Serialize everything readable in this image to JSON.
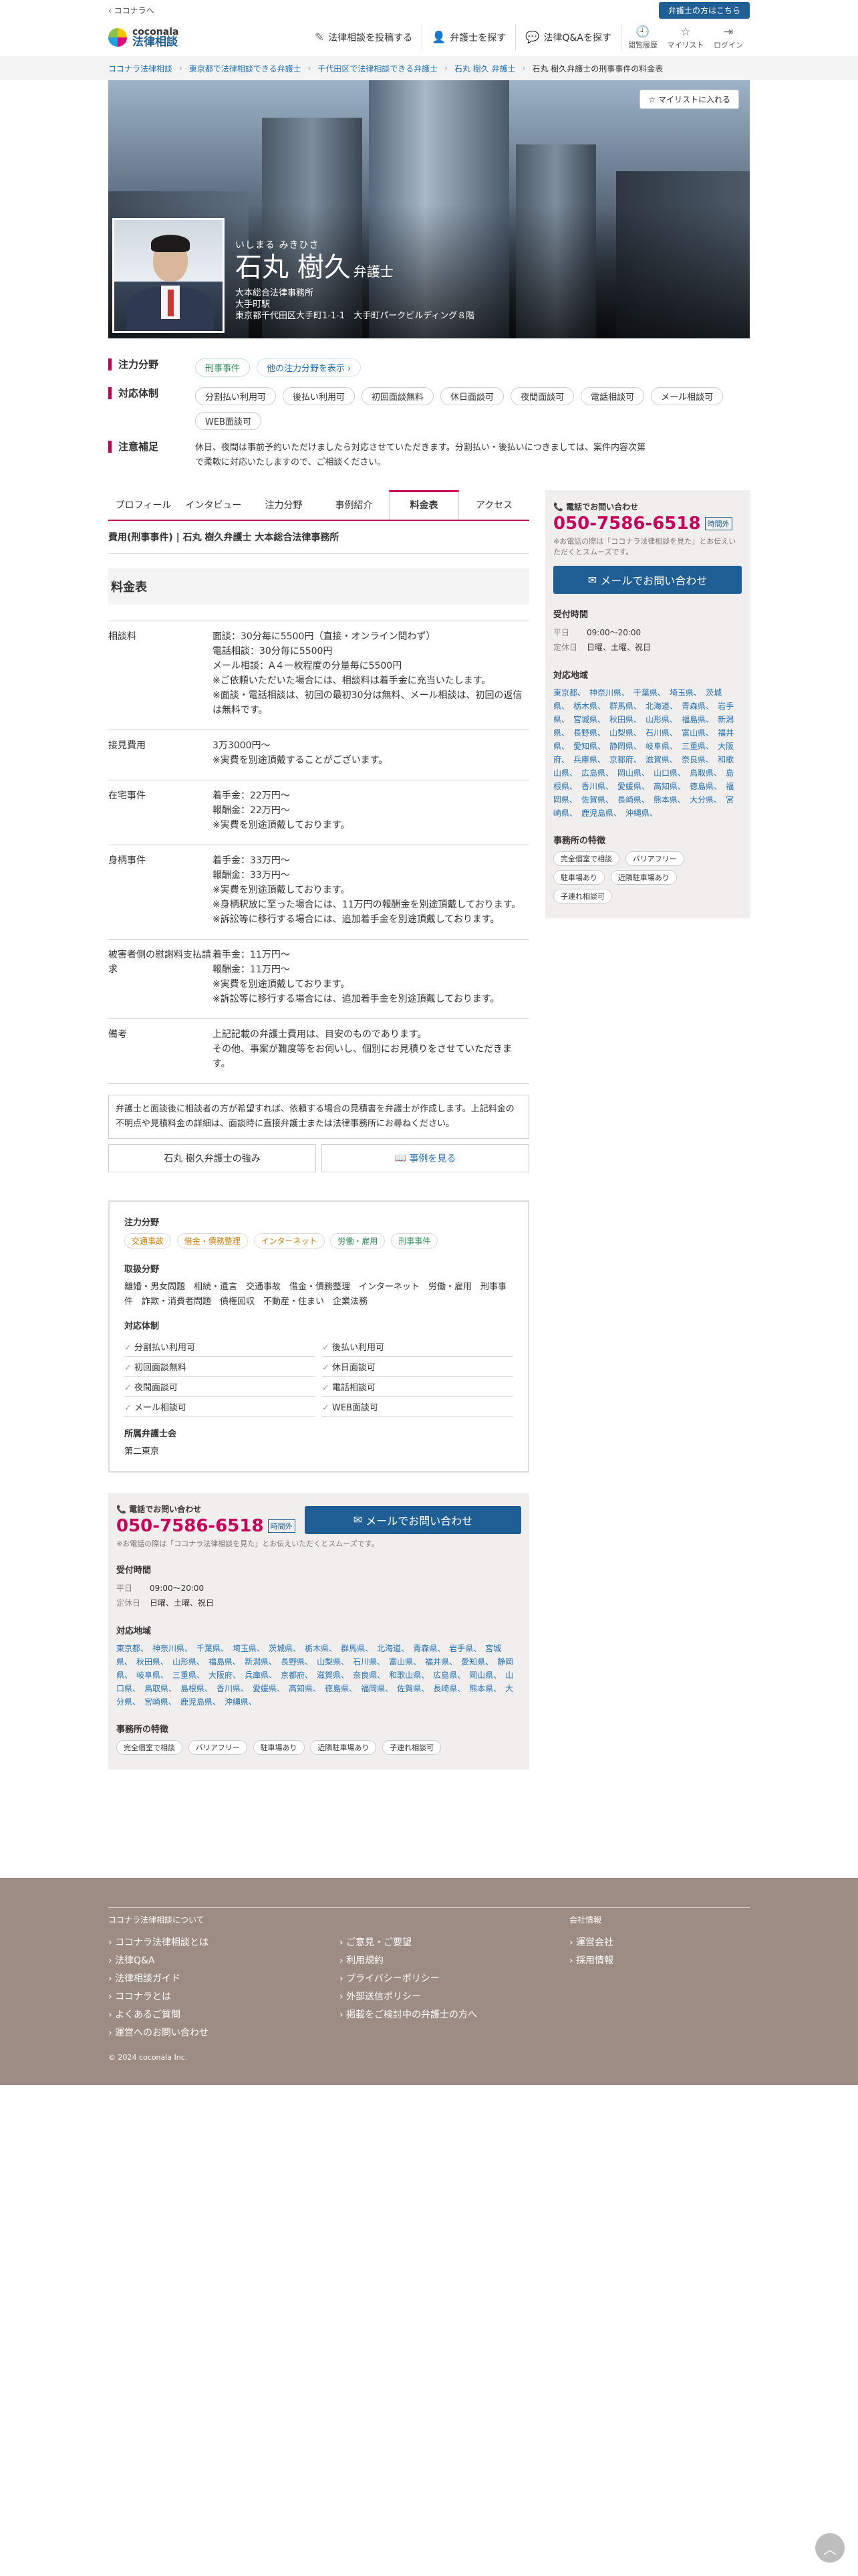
{
  "topbar": {
    "back": "‹ ココナラへ",
    "lawyer_btn": "弁護士の方はこちら"
  },
  "logo": {
    "line1": "coconala",
    "line2": "法律相談"
  },
  "nav": {
    "post": "法律相談を投稿する",
    "find": "弁護士を探す",
    "qa": "法律Q&Aを探す",
    "history": "閲覧履歴",
    "mylist": "マイリスト",
    "login": "ログイン"
  },
  "breadcrumb": [
    "ココナラ法律相談",
    "東京都で法律相談できる弁護士",
    "千代田区で法律相談できる弁護士",
    "石丸 樹久 弁護士",
    "石丸 樹久弁護士の刑事事件の料金表"
  ],
  "hero": {
    "fav": "マイリストに入れる",
    "kana": "いしまる みきひさ",
    "name": "石丸 樹久",
    "title": "弁護士",
    "firm": "大本総合法律事務所",
    "office": "大手町駅",
    "address": "東京都千代田区大手町1-1-1　大手町パークビルディング８階"
  },
  "features": {
    "focus_label": "注力分野",
    "focus_tag": "刑事事件",
    "focus_more": "他の注力分野を表示 ›",
    "support_label": "対応体制",
    "support_tags": [
      "分割払い利用可",
      "後払い利用可",
      "初回面談無料",
      "休日面談可",
      "夜間面談可",
      "電話相談可",
      "メール相談可",
      "WEB面談可"
    ],
    "note_label": "注意補足",
    "note_text": "休日、夜間は事前予約いただけましたら対応させていただきます。分割払い・後払いにつきましては、案件内容次第で柔軟に対応いたしますので、ご相談ください。"
  },
  "tabs": [
    "プロフィール",
    "インタビュー",
    "注力分野",
    "事例紹介",
    "料金表",
    "アクセス"
  ],
  "fee": {
    "subtitle": "費用(刑事事件) | 石丸 樹久弁護士 大本総合法律事務所",
    "heading": "料金表",
    "rows": [
      {
        "label": "相談料",
        "content": "面談：30分毎に5500円（直接・オンライン問わず）\n電話相談：30分毎に5500円\nメール相談：A４一枚程度の分量毎に5500円\n※ご依頼いただいた場合には、相談料は着手金に充当いたします。\n※面談・電話相談は、初回の最初30分は無料、メール相談は、初回の返信は無料です。"
      },
      {
        "label": "接見費用",
        "content": "3万3000円～\n※実費を別途頂戴することがございます。"
      },
      {
        "label": "在宅事件",
        "content": "着手金：22万円～\n報酬金：22万円～\n※実費を別途頂戴しております。"
      },
      {
        "label": "身柄事件",
        "content": "着手金：33万円～\n報酬金：33万円～\n※実費を別途頂戴しております。\n※身柄釈放に至った場合には、11万円の報酬金を別途頂戴しております。\n※訴訟等に移行する場合には、追加着手金を別途頂戴しております。"
      },
      {
        "label": "被害者側の慰謝料支払請求",
        "content": "着手金：11万円～\n報酬金：11万円～\n※実費を別途頂戴しております。\n※訴訟等に移行する場合には、追加着手金を別途頂戴しております。"
      },
      {
        "label": "備考",
        "content": "上記記載の弁護士費用は、目安のものであります。\nその他、事案が難度等をお伺いし、個別にお見積りをさせていただきます。"
      }
    ],
    "info": "弁護士と面談後に相談者の方が希望すれば、依頼する場合の見積書を弁護士が作成します。上記料金の不明点や見積料金の詳細は、面談時に直接弁護士または法律事務所にお尋ねください。",
    "strength_btn": "石丸 樹久弁護士の強み",
    "cases_btn": "事例を見る"
  },
  "summary": {
    "focus_h": "注力分野",
    "focus": [
      "交通事故",
      "借金・債務整理",
      "インターネット",
      "労働・雇用",
      "刑事事件"
    ],
    "handled_h": "取扱分野",
    "handled": "離婚・男女問題　相続・遺言　交通事故　借金・債務整理　インターネット　労働・雇用　刑事事件　詐欺・消費者問題　債権回収　不動産・住まい　企業法務",
    "support_h": "対応体制",
    "support": [
      "分割払い利用可",
      "後払い利用可",
      "初回面談無料",
      "休日面談可",
      "夜間面談可",
      "電話相談可",
      "メール相談可",
      "WEB面談可"
    ],
    "assoc_h": "所属弁護士会",
    "assoc": "第二東京"
  },
  "contact": {
    "tel_label": "電話でお問い合わせ",
    "tel": "050-7586-6518",
    "hours_badge": "時間外",
    "tel_note": "※お電話の際は「ココナラ法律相談を見た」とお伝えいただくとスムーズです。",
    "mail_btn": "メールでお問い合わせ",
    "hours_h": "受付時間",
    "weekday_k": "平日",
    "weekday_v": "09:00〜20:00",
    "holiday_k": "定休日",
    "holiday_v": "日曜、土曜、祝日",
    "regions_h": "対応地域",
    "regions": [
      "東京都",
      "神奈川県",
      "千葉県",
      "埼玉県",
      "茨城県",
      "栃木県",
      "群馬県",
      "北海道",
      "青森県",
      "岩手県",
      "宮城県",
      "秋田県",
      "山形県",
      "福島県",
      "新潟県",
      "長野県",
      "山梨県",
      "石川県",
      "富山県",
      "福井県",
      "愛知県",
      "静岡県",
      "岐阜県",
      "三重県",
      "大阪府",
      "兵庫県",
      "京都府",
      "滋賀県",
      "奈良県",
      "和歌山県",
      "広島県",
      "岡山県",
      "山口県",
      "鳥取県",
      "島根県",
      "香川県",
      "愛媛県",
      "高知県",
      "徳島県",
      "福岡県",
      "佐賀県",
      "長崎県",
      "熊本県",
      "大分県",
      "宮崎県",
      "鹿児島県",
      "沖縄県"
    ],
    "feat_h": "事務所の特徴",
    "features": [
      "完全個室で相談",
      "バリアフリー",
      "駐車場あり",
      "近隣駐車場あり",
      "子連れ相談可"
    ]
  },
  "footer": {
    "about": "ココナラ法律相談について",
    "company": "会社情報",
    "col1": [
      "ココナラ法律相談とは",
      "法律Q&A",
      "法律相談ガイド",
      "ココナラとは",
      "よくあるご質問",
      "運営へのお問い合わせ"
    ],
    "col2": [
      "ご意見・ご要望",
      "利用規約",
      "プライバシーポリシー",
      "外部送信ポリシー",
      "掲載をご検討中の弁護士の方へ"
    ],
    "col3": [
      "運営会社",
      "採用情報"
    ],
    "copyright": "© 2024 coconala Inc."
  }
}
